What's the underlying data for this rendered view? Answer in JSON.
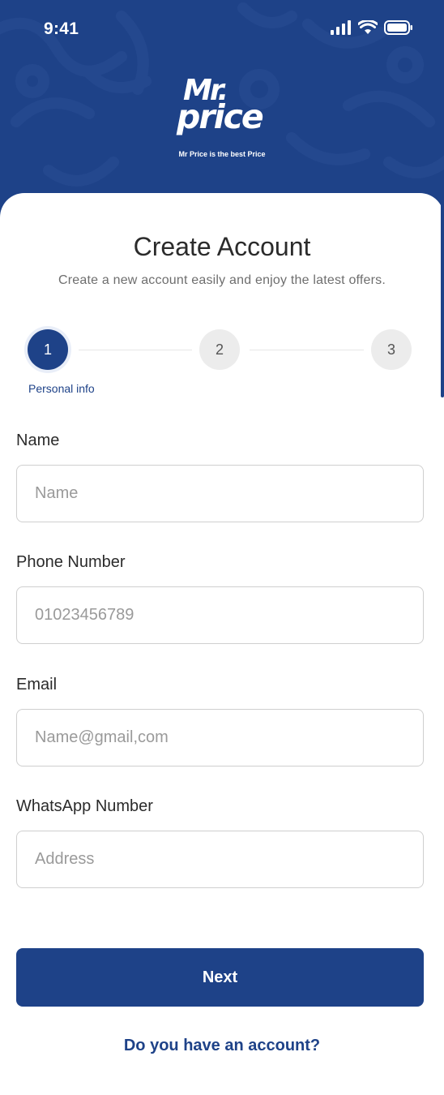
{
  "status_bar": {
    "time": "9:41",
    "icons": [
      "signal-icon",
      "wifi-icon",
      "battery-icon"
    ]
  },
  "brand": {
    "logo_line1": "Mr.",
    "logo_line2": "price",
    "tagline": "Mr Price is the best Price"
  },
  "page": {
    "title": "Create Account",
    "subtitle": "Create a new account easily and enjoy the latest offers."
  },
  "stepper": {
    "steps": [
      {
        "number": "1",
        "label": "Personal info",
        "active": true
      },
      {
        "number": "2",
        "active": false
      },
      {
        "number": "3",
        "active": false
      }
    ]
  },
  "form": {
    "name": {
      "label": "Name",
      "placeholder": "Name",
      "value": ""
    },
    "phone": {
      "label": "Phone Number",
      "placeholder": "01023456789",
      "value": ""
    },
    "email": {
      "label": "Email",
      "placeholder": "Name@gmail,com",
      "value": ""
    },
    "whatsapp": {
      "label": "WhatsApp Number",
      "placeholder": "Address",
      "value": ""
    }
  },
  "actions": {
    "next_label": "Next",
    "login_link": "Do you have an account?"
  },
  "colors": {
    "brand_blue": "#1e4288",
    "input_border": "#cfcfcf",
    "step_inactive": "#ececec"
  }
}
